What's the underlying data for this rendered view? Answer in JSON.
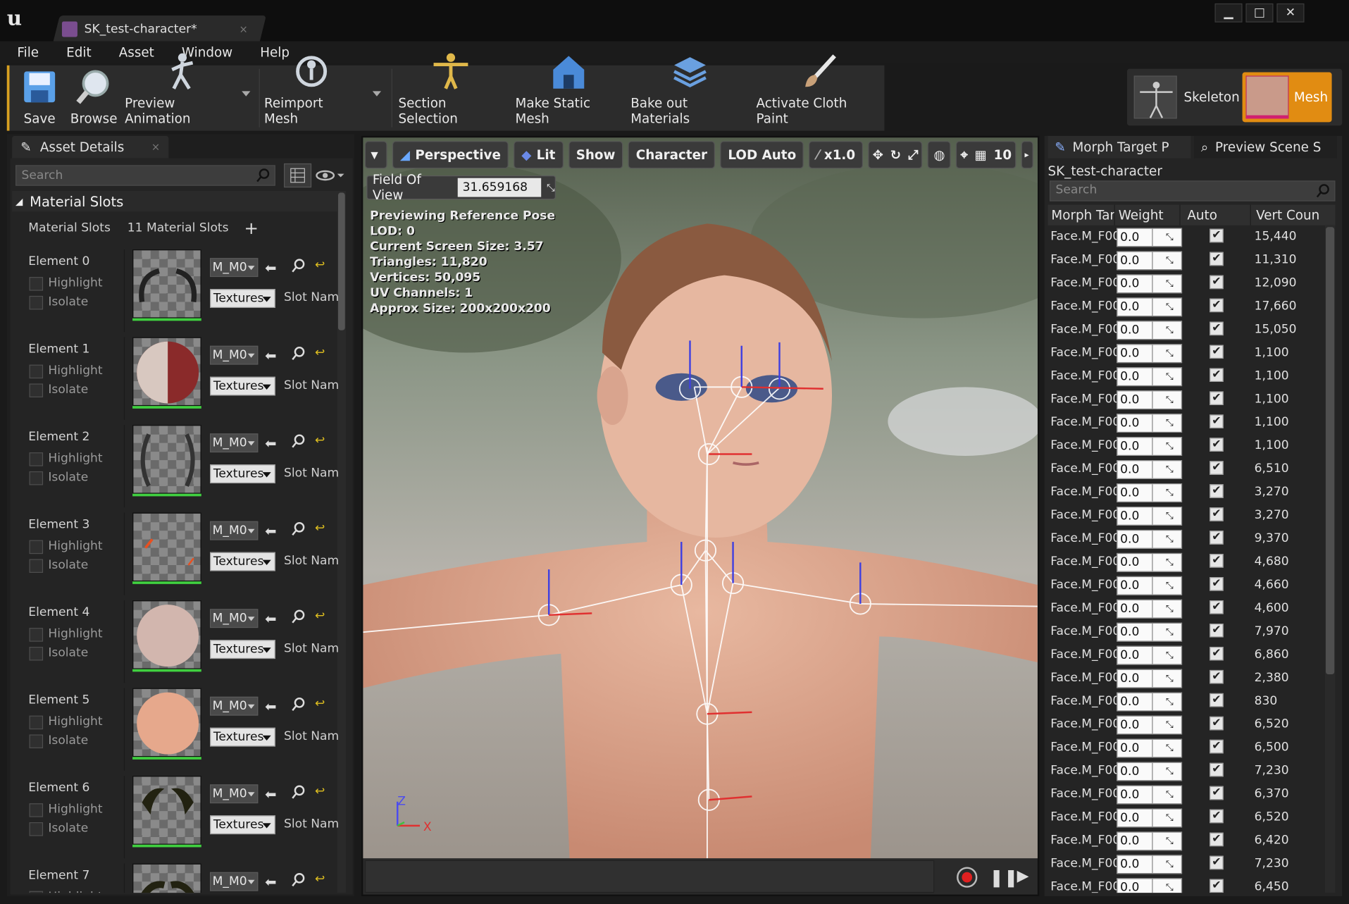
{
  "window": {
    "tab_title": "SK_test-character*",
    "close_glyph": "×",
    "logo_text": "u",
    "buttons": {
      "minimize": "▁",
      "maximize": "□",
      "close": "✕"
    }
  },
  "menu": [
    "File",
    "Edit",
    "Asset",
    "Window",
    "Help"
  ],
  "toolbar": {
    "save": "Save",
    "browse": "Browse",
    "preview_animation": "Preview Animation",
    "reimport_mesh": "Reimport Mesh",
    "section_selection": "Section Selection",
    "make_static_mesh": "Make Static Mesh",
    "bake_out_materials": "Bake out Materials",
    "activate_cloth_paint": "Activate Cloth Paint"
  },
  "modes": {
    "skeleton": "Skeleton",
    "mesh": "Mesh"
  },
  "asset_details": {
    "tab": "Asset Details",
    "search_placeholder": "Search",
    "section": "Material Slots",
    "slots_label": "Material Slots",
    "slots_count": "11 Material Slots",
    "add_glyph": "+",
    "elements": [
      {
        "name": "Element 0",
        "material": "M_M0",
        "textures": "Textures",
        "slot": "Slot Name"
      },
      {
        "name": "Element 1",
        "material": "M_M0",
        "textures": "Textures",
        "slot": "Slot Name"
      },
      {
        "name": "Element 2",
        "material": "M_M0",
        "textures": "Textures",
        "slot": "Slot Name"
      },
      {
        "name": "Element 3",
        "material": "M_M0",
        "textures": "Textures",
        "slot": "Slot Name"
      },
      {
        "name": "Element 4",
        "material": "M_M0",
        "textures": "Textures",
        "slot": "Slot Name"
      },
      {
        "name": "Element 5",
        "material": "M_M0",
        "textures": "Textures",
        "slot": "Slot Name"
      },
      {
        "name": "Element 6",
        "material": "M_M0",
        "textures": "Textures",
        "slot": "Slot Name"
      },
      {
        "name": "Element 7",
        "material": "M_M0",
        "textures": "",
        "slot": ""
      }
    ],
    "highlight": "Highlight",
    "isolate": "Isolate"
  },
  "viewport": {
    "buttons": {
      "perspective": "Perspective",
      "lit": "Lit",
      "show": "Show",
      "character": "Character",
      "lod": "LOD Auto",
      "speed": "x1.0",
      "grid_snap": "10"
    },
    "fov_label": "Field Of View",
    "fov_value": "31.659168",
    "stats": [
      "Previewing Reference Pose",
      "LOD: 0",
      "Current Screen Size: 3.57",
      "Triangles: 11,820",
      "Vertices: 50,095",
      "UV Channels: 1",
      "Approx Size: 200x200x200"
    ],
    "axis": {
      "z": "Z",
      "x": "X"
    }
  },
  "morph_panel": {
    "tab_morph": "Morph Target P",
    "tab_scene": "Preview Scene S",
    "asset_name": "SK_test-character",
    "search_placeholder": "Search",
    "columns": [
      "Morph Tar",
      "Weight",
      "Auto",
      "Vert Coun"
    ],
    "check_glyph": "✔",
    "rows": [
      {
        "name": "Face.M_F00",
        "weight": "0.0",
        "verts": "15,440"
      },
      {
        "name": "Face.M_F00",
        "weight": "0.0",
        "verts": "11,310"
      },
      {
        "name": "Face.M_F00",
        "weight": "0.0",
        "verts": "12,090"
      },
      {
        "name": "Face.M_F00",
        "weight": "0.0",
        "verts": "17,660"
      },
      {
        "name": "Face.M_F00",
        "weight": "0.0",
        "verts": "15,050"
      },
      {
        "name": "Face.M_F00",
        "weight": "0.0",
        "verts": "1,100"
      },
      {
        "name": "Face.M_F00",
        "weight": "0.0",
        "verts": "1,100"
      },
      {
        "name": "Face.M_F00",
        "weight": "0.0",
        "verts": "1,100"
      },
      {
        "name": "Face.M_F00",
        "weight": "0.0",
        "verts": "1,100"
      },
      {
        "name": "Face.M_F00",
        "weight": "0.0",
        "verts": "1,100"
      },
      {
        "name": "Face.M_F00",
        "weight": "0.0",
        "verts": "6,510"
      },
      {
        "name": "Face.M_F00",
        "weight": "0.0",
        "verts": "3,270"
      },
      {
        "name": "Face.M_F00",
        "weight": "0.0",
        "verts": "3,270"
      },
      {
        "name": "Face.M_F00",
        "weight": "0.0",
        "verts": "9,370"
      },
      {
        "name": "Face.M_F00",
        "weight": "0.0",
        "verts": "4,680"
      },
      {
        "name": "Face.M_F00",
        "weight": "0.0",
        "verts": "4,660"
      },
      {
        "name": "Face.M_F00",
        "weight": "0.0",
        "verts": "4,600"
      },
      {
        "name": "Face.M_F00",
        "weight": "0.0",
        "verts": "7,970"
      },
      {
        "name": "Face.M_F00",
        "weight": "0.0",
        "verts": "6,860"
      },
      {
        "name": "Face.M_F00",
        "weight": "0.0",
        "verts": "2,380"
      },
      {
        "name": "Face.M_F00",
        "weight": "0.0",
        "verts": "830"
      },
      {
        "name": "Face.M_F00",
        "weight": "0.0",
        "verts": "6,520"
      },
      {
        "name": "Face.M_F00",
        "weight": "0.0",
        "verts": "6,500"
      },
      {
        "name": "Face.M_F00",
        "weight": "0.0",
        "verts": "7,230"
      },
      {
        "name": "Face.M_F00",
        "weight": "0.0",
        "verts": "6,370"
      },
      {
        "name": "Face.M_F00",
        "weight": "0.0",
        "verts": "6,520"
      },
      {
        "name": "Face.M_F00",
        "weight": "0.0",
        "verts": "6,420"
      },
      {
        "name": "Face.M_F00",
        "weight": "0.0",
        "verts": "7,230"
      },
      {
        "name": "Face.M_F00",
        "weight": "0.0",
        "verts": "6,450"
      }
    ]
  },
  "colors": {
    "accent": "#e18c12",
    "toolbar_edge": "#d8a020",
    "record": "#e02020"
  }
}
